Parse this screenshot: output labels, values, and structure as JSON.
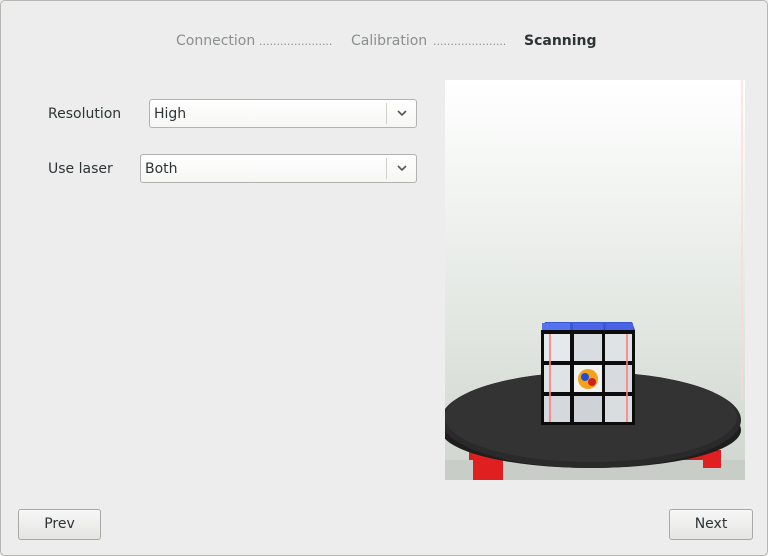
{
  "wizard": {
    "steps": [
      {
        "label": "Connection",
        "active": false
      },
      {
        "label": "Calibration",
        "active": false
      },
      {
        "label": "Scanning",
        "active": true
      }
    ],
    "separator": "....................."
  },
  "form": {
    "resolution_label": "Resolution",
    "resolution_value": "High",
    "laser_label": "Use laser",
    "laser_value": "Both"
  },
  "preview": {
    "subject": "rubiks-cube-on-turntable"
  },
  "buttons": {
    "prev_label": "Prev",
    "next_label": "Next"
  },
  "colors": {
    "active_step": "#2e3436",
    "inactive_step": "#8b8e8f",
    "window_bg": "#ededed"
  }
}
